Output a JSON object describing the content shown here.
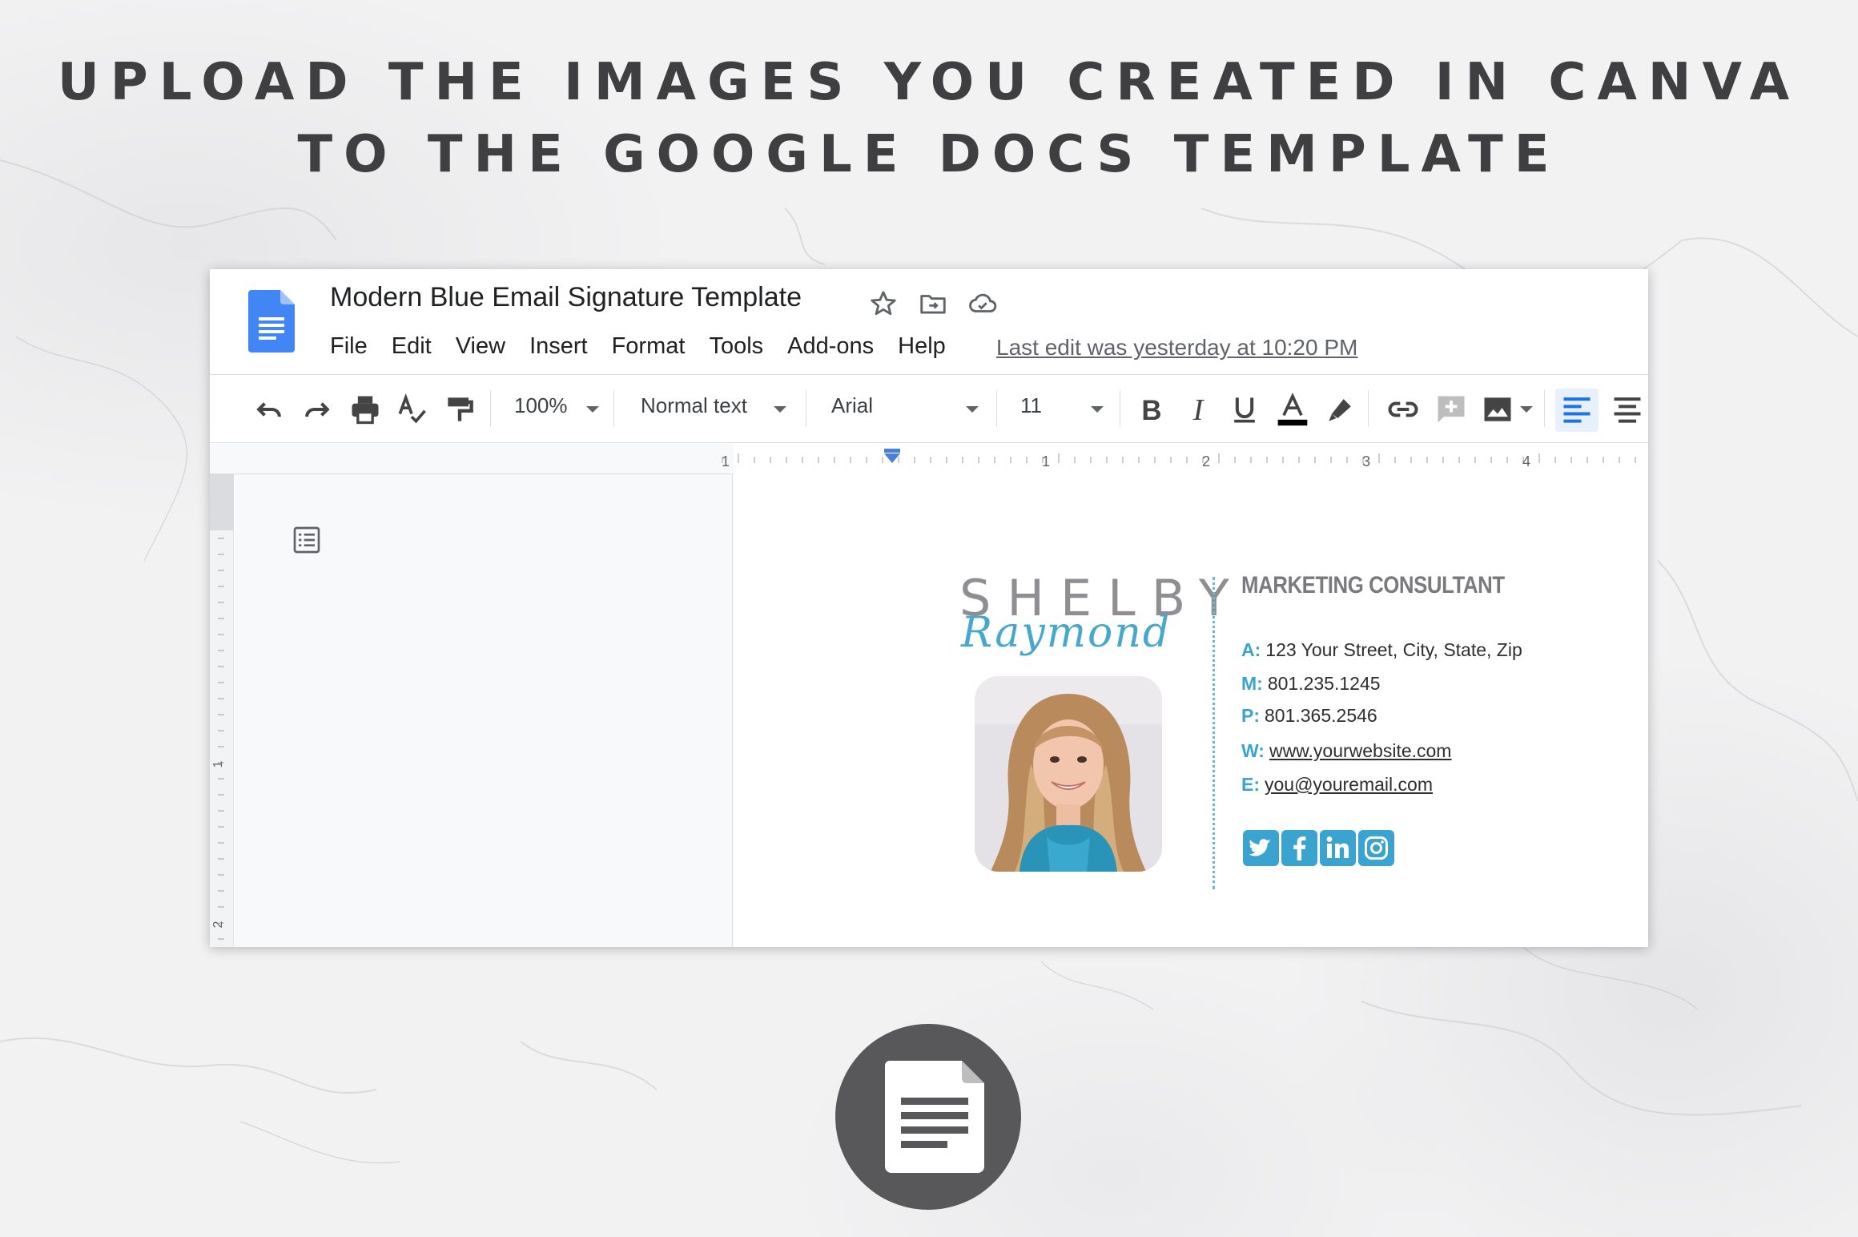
{
  "headline": {
    "line1": "UPLOAD THE IMAGES YOU CREATED IN CANVA",
    "line2": "TO THE GOOGLE DOCS TEMPLATE"
  },
  "docs": {
    "title": "Modern Blue Email Signature Template",
    "title_icons": [
      "star-icon",
      "move-to-folder-icon",
      "cloud-saved-icon"
    ],
    "menu": [
      "File",
      "Edit",
      "View",
      "Insert",
      "Format",
      "Tools",
      "Add-ons",
      "Help"
    ],
    "last_edit": "Last edit was yesterday at 10:20 PM",
    "toolbar": {
      "zoom": "100%",
      "style": "Normal text",
      "font": "Arial",
      "font_size": "11",
      "icons": [
        "undo-icon",
        "redo-icon",
        "print-icon",
        "spellcheck-icon",
        "paint-format-icon",
        "bold-icon",
        "italic-icon",
        "underline-icon",
        "text-color-icon",
        "highlight-icon",
        "link-icon",
        "comment-icon",
        "image-icon",
        "align-left-icon",
        "align-center-icon"
      ]
    },
    "ruler": {
      "labels": [
        "1",
        "1",
        "2",
        "3",
        "4"
      ]
    },
    "left_ruler": {
      "labels": [
        "1",
        "2"
      ]
    }
  },
  "signature": {
    "first_name": "SHELBY",
    "last_name": "Raymond",
    "job_title": "MARKETING CONSULTANT",
    "contacts": [
      {
        "label": "A:",
        "value": "123 Your Street, City, State, Zip",
        "link": false
      },
      {
        "label": "M:",
        "value": "801.235.1245",
        "link": false
      },
      {
        "label": "P:",
        "value": "801.365.2546",
        "link": false
      },
      {
        "label": "W:",
        "value": "www.yourwebsite.com",
        "link": true
      },
      {
        "label": "E:",
        "value": "you@youremail.com",
        "link": true
      }
    ],
    "social": [
      "twitter-icon",
      "facebook-icon",
      "linkedin-icon",
      "instagram-icon"
    ],
    "accent_color": "#3aa3cf"
  },
  "colors": {
    "headline": "#3f3f42",
    "docs_blue": "#4285f4",
    "badge": "#58585b"
  }
}
